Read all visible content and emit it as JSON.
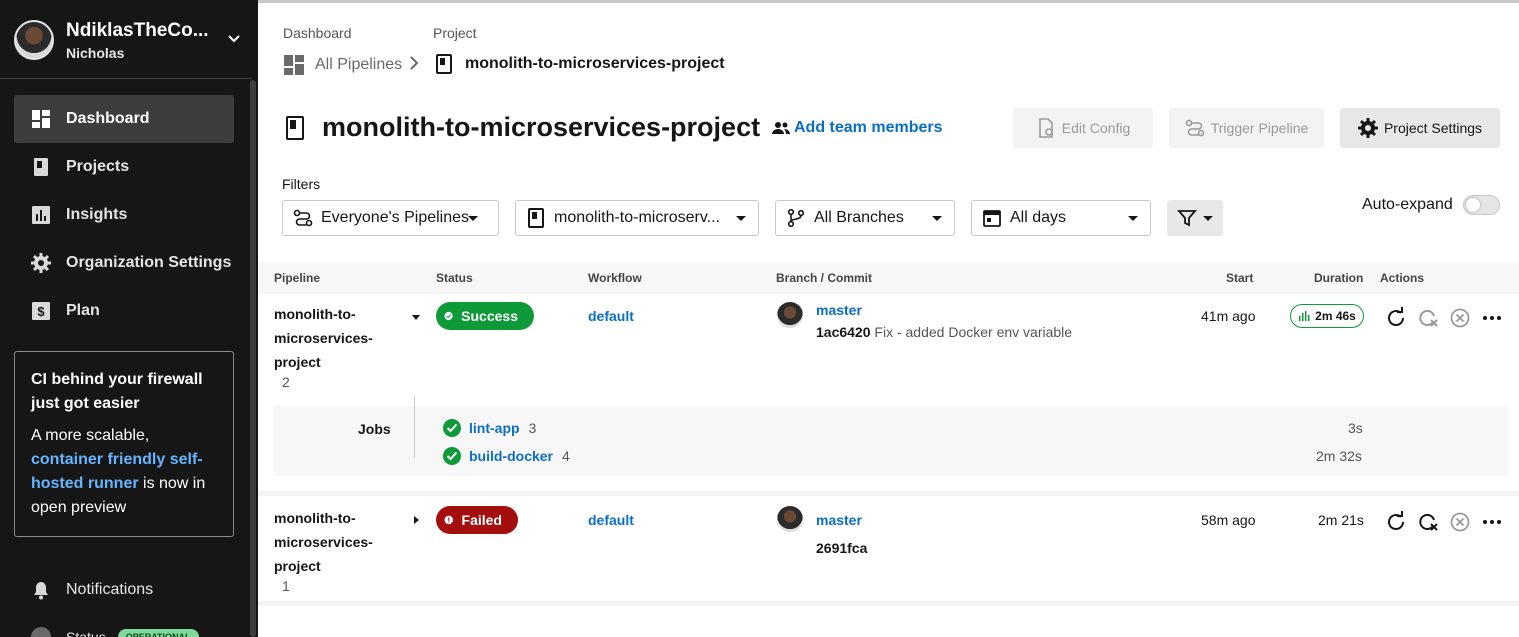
{
  "sidebar": {
    "org_name": "NdiklasTheCo...",
    "user_name": "Nicholas",
    "nav": [
      {
        "label": "Dashboard",
        "icon": "dashboard-icon",
        "active": true
      },
      {
        "label": "Projects",
        "icon": "projects-icon"
      },
      {
        "label": "Insights",
        "icon": "insights-icon"
      },
      {
        "label": "Organization Settings",
        "icon": "gear-icon"
      },
      {
        "label": "Plan",
        "icon": "dollar-icon"
      }
    ],
    "promo": {
      "title": "CI behind your firewall just got easier",
      "body_pre": "A more scalable, ",
      "body_link": "container friendly self-hosted runner",
      "body_post": " is now in open preview"
    },
    "notifications": "Notifications",
    "status_label": "Status",
    "status_badge": "OPERATIONAL"
  },
  "breadcrumb": {
    "level1_label": "Dashboard",
    "level1_value": "All Pipelines",
    "level2_label": "Project",
    "level2_value": "monolith-to-microservices-project"
  },
  "header": {
    "title": "monolith-to-microservices-project",
    "add_team": "Add team members",
    "edit_config": "Edit Config",
    "trigger_pipeline": "Trigger Pipeline",
    "project_settings": "Project Settings"
  },
  "filters": {
    "label": "Filters",
    "pipelines": "Everyone's Pipelines",
    "project": "monolith-to-microserv...",
    "branches": "All Branches",
    "days": "All days",
    "auto_expand": "Auto-expand"
  },
  "table": {
    "columns": [
      "Pipeline",
      "Status",
      "Workflow",
      "Branch / Commit",
      "Start",
      "Duration",
      "Actions"
    ],
    "rows": [
      {
        "pipeline": "monolith-to-microservices-project",
        "number": "2",
        "status": "Success",
        "workflow": "default",
        "branch": "master",
        "commit_hash": "1ac6420",
        "commit_msg": "Fix - added Docker env variable",
        "start": "41m ago",
        "duration": "2m 46s",
        "jobs_label": "Jobs",
        "jobs": [
          {
            "name": "lint-app",
            "count": "3",
            "duration": "3s"
          },
          {
            "name": "build-docker",
            "count": "4",
            "duration": "2m 32s"
          }
        ]
      },
      {
        "pipeline": "monolith-to-microservices-project",
        "number": "1",
        "status": "Failed",
        "workflow": "default",
        "branch": "master",
        "commit_hash": "2691fca",
        "commit_msg": "",
        "start": "58m ago",
        "duration": "2m 21s"
      }
    ]
  },
  "colors": {
    "sidebar_bg": "#161616",
    "success": "#0f9a3a",
    "failed": "#a50e0e",
    "link": "#0b6ec5"
  }
}
